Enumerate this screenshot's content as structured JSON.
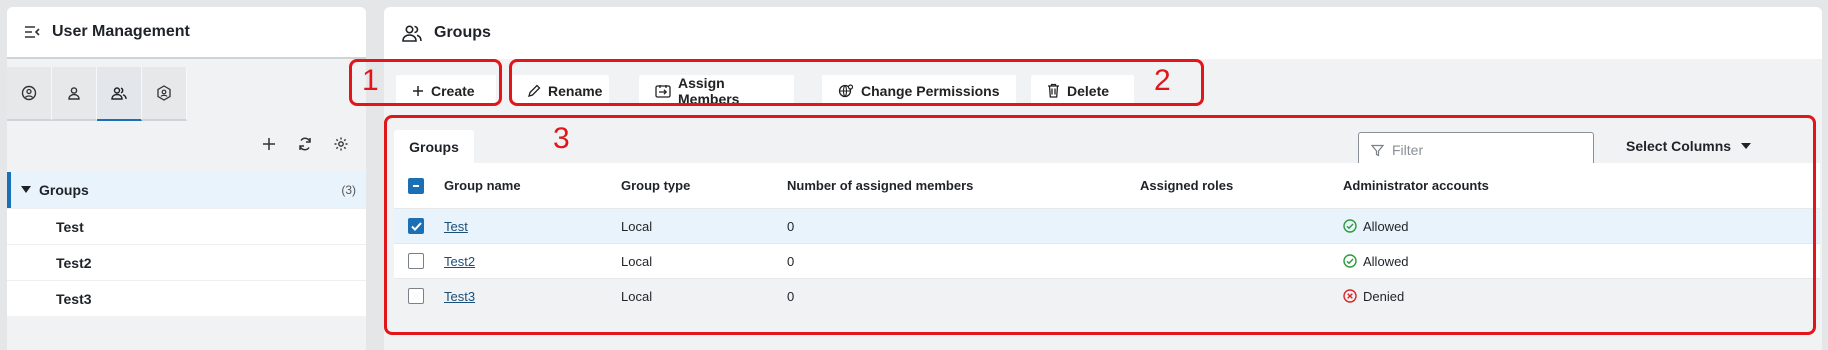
{
  "left_panel": {
    "title": "User Management",
    "view_tabs": [
      {
        "name": "user-circle-icon"
      },
      {
        "name": "user-icon"
      },
      {
        "name": "users-icon"
      },
      {
        "name": "shield-user-icon"
      }
    ],
    "toolbar": {
      "add": "plus-icon",
      "refresh": "refresh-icon",
      "settings": "settings-icon"
    },
    "tree": {
      "root_label": "Groups",
      "root_count": "(3)",
      "items": [
        "Test",
        "Test2",
        "Test3"
      ]
    }
  },
  "right_panel": {
    "title": "Groups",
    "actions": {
      "create": "Create",
      "rename": "Rename",
      "assign_members": "Assign Members",
      "change_permissions": "Change Permissions",
      "delete": "Delete"
    },
    "grid": {
      "tab_label": "Groups",
      "filter_placeholder": "Filter",
      "select_columns": "Select Columns",
      "columns": [
        "Group name",
        "Group type",
        "Number of assigned members",
        "Assigned roles",
        "Administrator accounts"
      ],
      "rows": [
        {
          "selected": true,
          "name": "Test",
          "type": "Local",
          "members": "0",
          "roles": "",
          "admin": "Allowed",
          "admin_status": "allowed"
        },
        {
          "selected": false,
          "name": "Test2",
          "type": "Local",
          "members": "0",
          "roles": "",
          "admin": "Allowed",
          "admin_status": "allowed"
        },
        {
          "selected": false,
          "name": "Test3",
          "type": "Local",
          "members": "0",
          "roles": "",
          "admin": "Denied",
          "admin_status": "denied"
        }
      ]
    }
  },
  "annotations": [
    "1",
    "2",
    "3"
  ],
  "colors": {
    "accent": "#1a6fb5",
    "annotation": "#e0161b",
    "allowed": "#2e9a3e",
    "denied": "#d9252a"
  }
}
